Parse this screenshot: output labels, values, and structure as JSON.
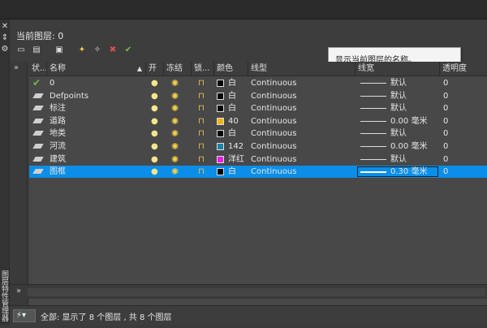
{
  "current_layer": "当前图层: 0",
  "tooltip": "显示当前图层的名称。",
  "toolbar": {
    "icons": [
      "new-property-filter-icon",
      "new-group-filter-icon",
      "layer-states-icon",
      "new-layer-icon",
      "new-layer-vp-frozen-icon",
      "delete-layer-icon",
      "set-current-icon"
    ]
  },
  "columns": {
    "status": "状...",
    "name": "名称",
    "on": "开",
    "freeze": "冻结",
    "lock": "锁...",
    "color": "颜色",
    "linetype": "线型",
    "lineweight": "线宽",
    "transparency": "透明度"
  },
  "layers": [
    {
      "status": "current",
      "name": "0",
      "color_hex": "#000000",
      "color": "白",
      "linetype": "Continuous",
      "lineweight": "默认",
      "transparency": "0"
    },
    {
      "status": "layer",
      "name": "Defpoints",
      "color_hex": "#000000",
      "color": "白",
      "linetype": "Continuous",
      "lineweight": "默认",
      "transparency": "0"
    },
    {
      "status": "layer",
      "name": "标注",
      "color_hex": "#000000",
      "color": "白",
      "linetype": "Continuous",
      "lineweight": "默认",
      "transparency": "0"
    },
    {
      "status": "layer",
      "name": "道路",
      "color_hex": "#f0b400",
      "color": "40",
      "linetype": "Continuous",
      "lineweight": "0.00 毫米",
      "transparency": "0"
    },
    {
      "status": "layer",
      "name": "地类",
      "color_hex": "#000000",
      "color": "白",
      "linetype": "Continuous",
      "lineweight": "默认",
      "transparency": "0"
    },
    {
      "status": "layer",
      "name": "河流",
      "color_hex": "#1f7fa8",
      "color": "142",
      "linetype": "Continuous",
      "lineweight": "0.00 毫米",
      "transparency": "0"
    },
    {
      "status": "layer",
      "name": "建筑",
      "color_hex": "#e61ee6",
      "color": "洋红",
      "linetype": "Continuous",
      "lineweight": "默认",
      "transparency": "0"
    },
    {
      "status": "layer",
      "name": "图框",
      "color_hex": "#000000",
      "color": "白",
      "linetype": "Continuous",
      "lineweight": "0.30 毫米",
      "transparency": "0"
    }
  ],
  "selected_row": 7,
  "status_bar": {
    "filter_icon": "layer-filter-icon",
    "text": "全部: 显示了 8 个图层 , 共 8 个图层"
  },
  "side_title": "图层特性管理器"
}
